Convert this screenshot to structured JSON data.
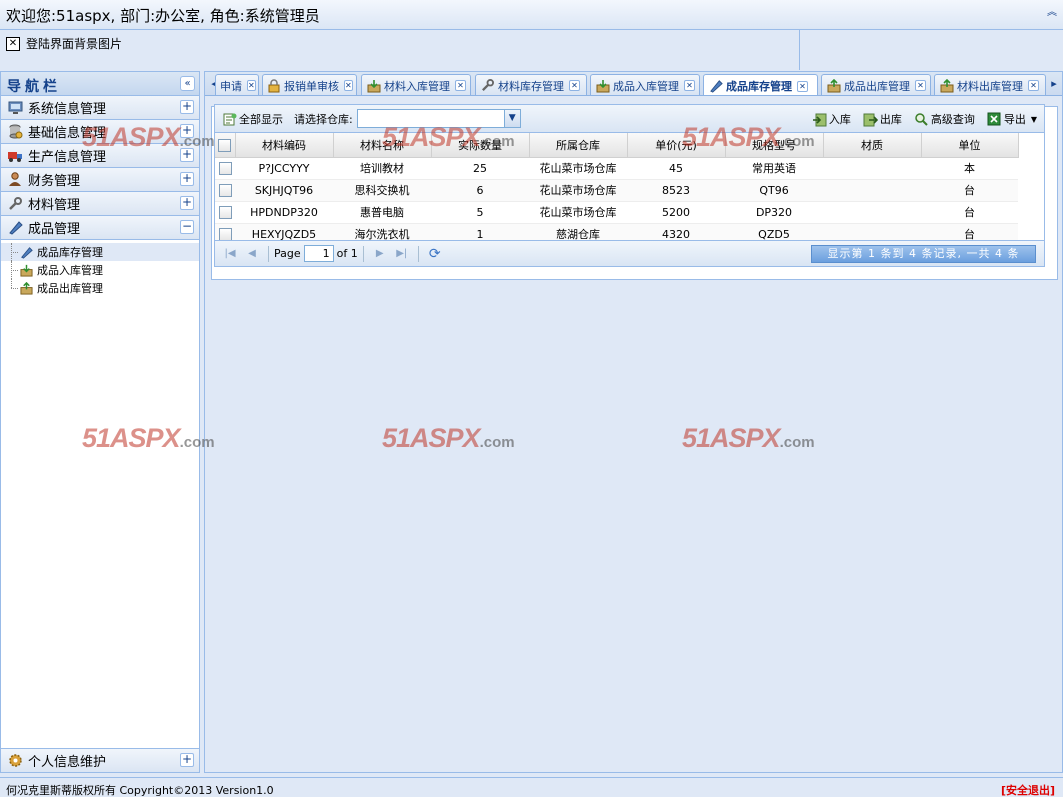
{
  "header": {
    "welcome": "欢迎您:51aspx,    部门:办公室,    角色:系统管理员",
    "collapse_glyph": "︽"
  },
  "banner": {
    "broken_image_alt": "登陆界面背景图片"
  },
  "nav": {
    "title": "导航栏",
    "collapse_glyph": "«",
    "sections": [
      {
        "label": "系统信息管理",
        "icon": "computer-icon",
        "toggle": "+"
      },
      {
        "label": "基础信息管理",
        "icon": "database-icon",
        "toggle": "+"
      },
      {
        "label": "生产信息管理",
        "icon": "truck-icon",
        "toggle": "+"
      },
      {
        "label": "财务管理",
        "icon": "user-icon",
        "toggle": "+"
      },
      {
        "label": "材料管理",
        "icon": "wrench-icon",
        "toggle": "+"
      },
      {
        "label": "成品管理",
        "icon": "pen-icon",
        "toggle": "−"
      }
    ],
    "sub_items": [
      {
        "label": "成品库存管理",
        "icon": "pen-icon"
      },
      {
        "label": "成品入库管理",
        "icon": "box-in-icon"
      },
      {
        "label": "成品出库管理",
        "icon": "box-out-icon"
      }
    ],
    "bottom_section": {
      "label": "个人信息维护",
      "icon": "gear-icon",
      "toggle": "+"
    }
  },
  "tabs": {
    "left_scroll": "◂",
    "right_scroll": "▸",
    "items": [
      {
        "label": "申请",
        "icon": ""
      },
      {
        "label": "报销单审核",
        "icon": "lock-icon"
      },
      {
        "label": "材料入库管理",
        "icon": "box-in-icon"
      },
      {
        "label": "材料库存管理",
        "icon": "wrench-icon"
      },
      {
        "label": "成品入库管理",
        "icon": "box-in-icon"
      },
      {
        "label": "成品库存管理",
        "icon": "pen-icon",
        "active": true
      },
      {
        "label": "成品出库管理",
        "icon": "box-out-icon"
      },
      {
        "label": "材料出库管理",
        "icon": "box-out-icon"
      }
    ]
  },
  "toolbar": {
    "show_all": "全部显示",
    "warehouse_label": "请选择仓库:",
    "warehouse_value": "",
    "stock_in": "入库",
    "stock_out": "出库",
    "advanced_search": "高级查询",
    "export": "导出"
  },
  "table": {
    "columns": [
      "材料编码",
      "材料名称",
      "实际数量",
      "所属仓库",
      "单价(元)",
      "规格型号",
      "材质",
      "单位"
    ],
    "rows": [
      [
        "P?JCCYYY",
        "培训教材",
        "25",
        "花山菜市场仓库",
        "45",
        "常用英语",
        "",
        "本"
      ],
      [
        "SKJHJQT96",
        "思科交换机",
        "6",
        "花山菜市场仓库",
        "8523",
        "QT96",
        "",
        "台"
      ],
      [
        "HPDNDP320",
        "惠普电脑",
        "5",
        "花山菜市场仓库",
        "5200",
        "DP320",
        "",
        "台"
      ],
      [
        "HEXYJQZD5",
        "海尔洗衣机",
        "1",
        "慈湖仓库",
        "4320",
        "QZD5",
        "",
        "台"
      ]
    ]
  },
  "pager": {
    "page_label": "Page",
    "page_value": "1",
    "of_label": "of 1",
    "info": "显示第 1 条到 4 条记录, 一共 4 条"
  },
  "footer": {
    "copyright": "何况克里斯蒂版权所有  Copyright©2013 Version1.0",
    "logout": "[安全退出]"
  },
  "watermark": {
    "main": "51ASPX",
    "suffix": ".com"
  },
  "colors": {
    "accent": "#15428b",
    "border": "#99bbe8",
    "panel": "#dfe8f6",
    "logout": "#dd0000",
    "watermark": "#c0392b"
  }
}
